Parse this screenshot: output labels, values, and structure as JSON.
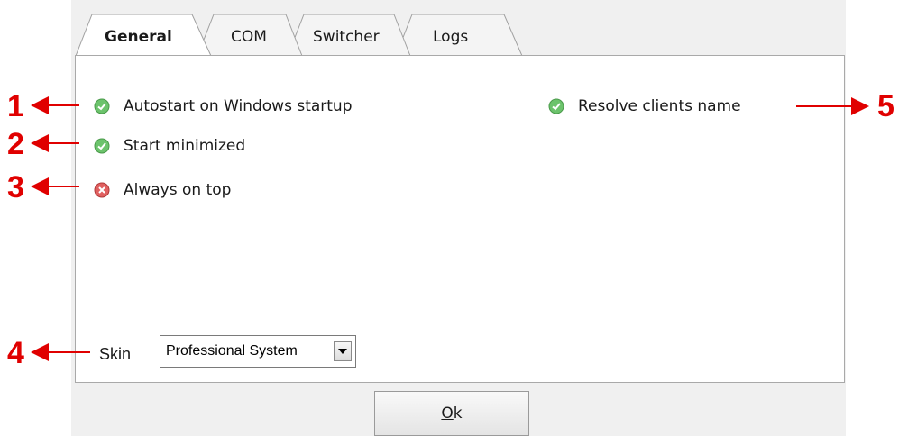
{
  "tabs": [
    {
      "label": "General",
      "active": true
    },
    {
      "label": "COM",
      "active": false
    },
    {
      "label": "Switcher",
      "active": false
    },
    {
      "label": "Logs",
      "active": false
    }
  ],
  "general": {
    "options": [
      {
        "label": "Autostart on Windows startup",
        "state": "enabled",
        "icon": "check-shield-icon"
      },
      {
        "label": "Start minimized",
        "state": "enabled",
        "icon": "check-shield-icon"
      },
      {
        "label": "Always on top",
        "state": "disabled",
        "icon": "x-circle-icon"
      },
      {
        "label": "Resolve clients name",
        "state": "enabled",
        "icon": "check-shield-icon"
      }
    ],
    "skin": {
      "label": "Skin",
      "value": "Professional System"
    }
  },
  "buttons": {
    "ok_mnemonic": "O",
    "ok_rest": "k"
  },
  "annotations": [
    "1",
    "2",
    "3",
    "4",
    "5"
  ],
  "colors": {
    "annotation": "#e00000",
    "enabled_icon": "#5cb85c",
    "disabled_icon": "#d9534f"
  }
}
